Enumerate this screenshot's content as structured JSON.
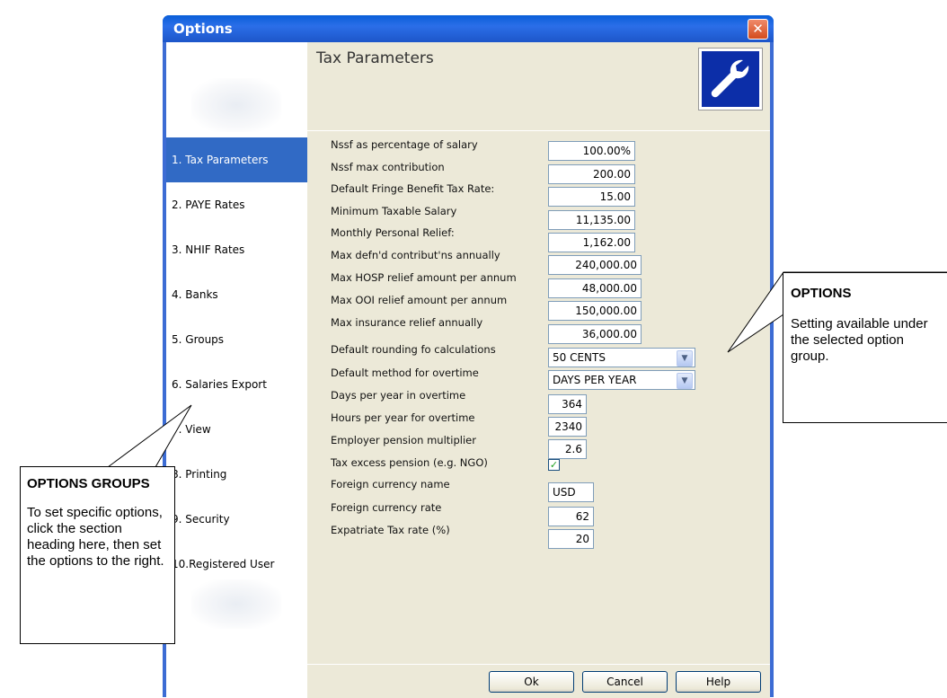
{
  "dialog": {
    "title": "Options",
    "close_glyph": "✕",
    "header_title": "Tax Parameters",
    "header_icon": "wrench-icon"
  },
  "nav": {
    "items": [
      {
        "label": "1. Tax Parameters",
        "selected": true
      },
      {
        "label": "2. PAYE Rates"
      },
      {
        "label": "3. NHIF Rates"
      },
      {
        "label": "4. Banks"
      },
      {
        "label": "5. Groups"
      },
      {
        "label": "6. Salaries Export"
      },
      {
        "label": "7. View"
      },
      {
        "label": "8. Printing"
      },
      {
        "label": "9. Security"
      },
      {
        "label": "10.Registered User"
      }
    ]
  },
  "settings": [
    {
      "label": "Nssf as percentage of salary",
      "value": "100.00%"
    },
    {
      "label": "Nssf max contribution",
      "value": "200.00"
    },
    {
      "label": "Default Fringe Benefit Tax Rate:",
      "value": "15.00"
    },
    {
      "label": "Minimum Taxable Salary",
      "value": "11,135.00"
    },
    {
      "label": "Monthly Personal Relief:",
      "value": "1,162.00"
    },
    {
      "label": "Max defn'd contribut'ns annually",
      "value": "240,000.00"
    },
    {
      "label": "Max HOSP relief amount per annum",
      "value": "48,000.00"
    },
    {
      "label": "Max OOI relief amount per annum",
      "value": "150,000.00"
    },
    {
      "label": "Max insurance relief annually",
      "value": "36,000.00"
    },
    {
      "label": "Default rounding fo calculations",
      "value": "50 CENTS"
    },
    {
      "label": "Default method for overtime",
      "value": "DAYS PER YEAR"
    },
    {
      "label": "Days per year in overtime",
      "value": "364"
    },
    {
      "label": "Hours per year for overtime",
      "value": "2340"
    },
    {
      "label": "Employer pension multiplier",
      "value": "2.6"
    },
    {
      "label": "Tax excess pension (e.g. NGO)",
      "value": "✓"
    },
    {
      "label": "Foreign currency name",
      "value": "USD"
    },
    {
      "label": "Foreign currency rate",
      "value": "62"
    },
    {
      "label": "Expatriate Tax rate (%)",
      "value": "20"
    }
  ],
  "buttons": {
    "ok": "Ok",
    "cancel": "Cancel",
    "help": "Help"
  },
  "callouts": {
    "options": {
      "title": "OPTIONS",
      "text": "Setting available under the selected option group."
    },
    "groups": {
      "title": "OPTIONS GROUPS",
      "text": "To set specific options, click the section heading here, then set the options to the right."
    }
  }
}
